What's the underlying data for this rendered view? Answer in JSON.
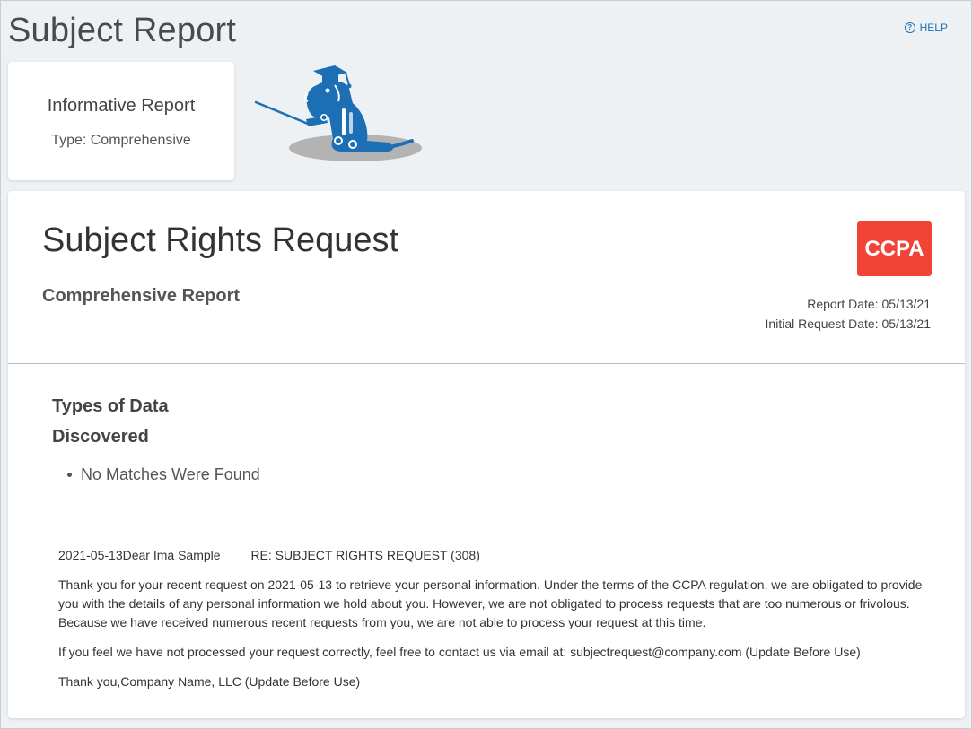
{
  "page": {
    "title": "Subject Report",
    "help_label": "HELP",
    "help_icon": "?"
  },
  "info_card": {
    "title": "Informative Report",
    "type": "Type: Comprehensive"
  },
  "report": {
    "title": "Subject Rights Request",
    "subtitle": "Comprehensive Report",
    "badge": "CCPA",
    "report_date": "Report Date: 05/13/21",
    "initial_request_date": "Initial Request Date: 05/13/21",
    "section_title": "Types of Data Discovered",
    "matches": [
      "No Matches Were Found"
    ]
  },
  "letter": {
    "date_greeting": "2021-05-13Dear  Ima Sample",
    "re_line": "RE: SUBJECT RIGHTS REQUEST (308)",
    "paragraph_1": "Thank you for your recent request on 2021-05-13 to retrieve your personal information. Under the terms of the CCPA regulation, we are obligated to provide you with the details of any personal information we hold about you. However, we are not obligated to process requests that are too numerous or frivolous. Because we have received numerous recent requests from you, we are not able to process your request at this time.",
    "paragraph_2": "If you feel we have not processed your request correctly, feel free to contact us via email at: subjectrequest@company.com (Update Before Use)",
    "signoff": "Thank you,Company Name, LLC (Update Before Use)"
  },
  "colors": {
    "accent": "#1a73b8",
    "badge": "#f14336",
    "mascot": "#1d6fb5"
  },
  "icons": {
    "help": "help-circle-icon",
    "mascot": "robot-dog-mascot-icon"
  }
}
